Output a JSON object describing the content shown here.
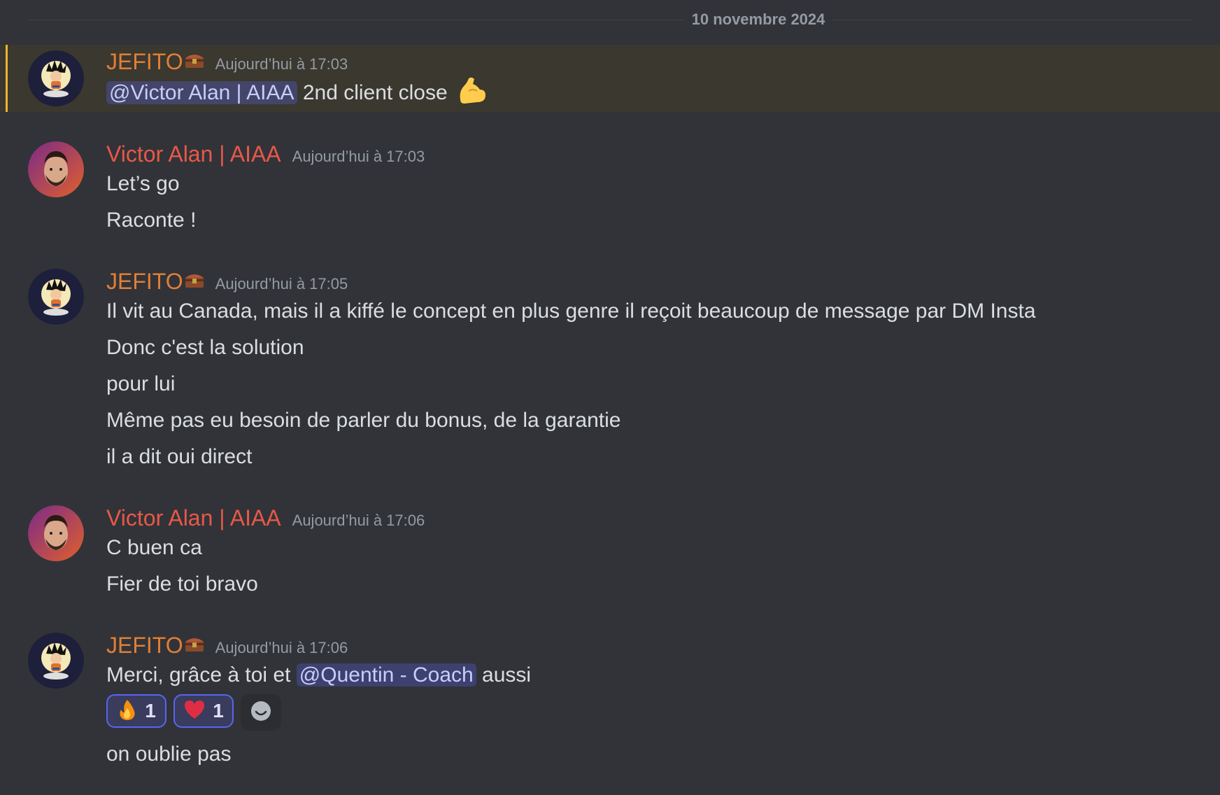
{
  "divider": {
    "label": "10 novembre 2024"
  },
  "messages": [
    {
      "author": "JEFITO",
      "author_badge_icon": "treasure-chest-emoji",
      "timestamp": "Aujourd’hui à 17:03",
      "highlighted": true,
      "line1": {
        "mention": "@Victor Alan | AIAA",
        "text": " 2nd client close",
        "emoji": "flexed-biceps-emoji"
      }
    },
    {
      "author": "Victor Alan | AIAA",
      "timestamp": "Aujourd’hui à 17:03",
      "lines": [
        "Let’s go",
        "Raconte !"
      ]
    },
    {
      "author": "JEFITO",
      "author_badge_icon": "treasure-chest-emoji",
      "timestamp": "Aujourd’hui à 17:05",
      "lines": [
        "Il vit au Canada, mais il a kiffé le concept en plus genre il reçoit beaucoup de message par DM Insta",
        "Donc c'est la solution",
        "pour lui",
        "Même pas eu besoin de parler du bonus, de la garantie",
        "il a dit oui direct"
      ]
    },
    {
      "author": "Victor Alan | AIAA",
      "timestamp": "Aujourd’hui à 17:06",
      "lines": [
        "C buen ca",
        "Fier de toi bravo"
      ]
    },
    {
      "author": "JEFITO",
      "author_badge_icon": "treasure-chest-emoji",
      "timestamp": "Aujourd’hui à 17:06",
      "line1": {
        "before": "Merci, grâce à toi et ",
        "mention": "@Quentin - Coach",
        "after": " aussi"
      },
      "reactions": [
        {
          "emoji": "fire-emoji",
          "count": "1"
        },
        {
          "emoji": "heart-emoji",
          "count": "1"
        }
      ],
      "add_reaction_icon": "add-reaction-smiley-icon",
      "line2": "on oublie pas"
    }
  ],
  "colors": {
    "background": "#313338",
    "highlight_bg": "#3a382f",
    "highlight_bar": "#f0b232",
    "jefito_name": "#e07f36",
    "victor_name": "#e85848",
    "mention_bg": "#3c4270",
    "reaction_border": "#5865f2"
  }
}
